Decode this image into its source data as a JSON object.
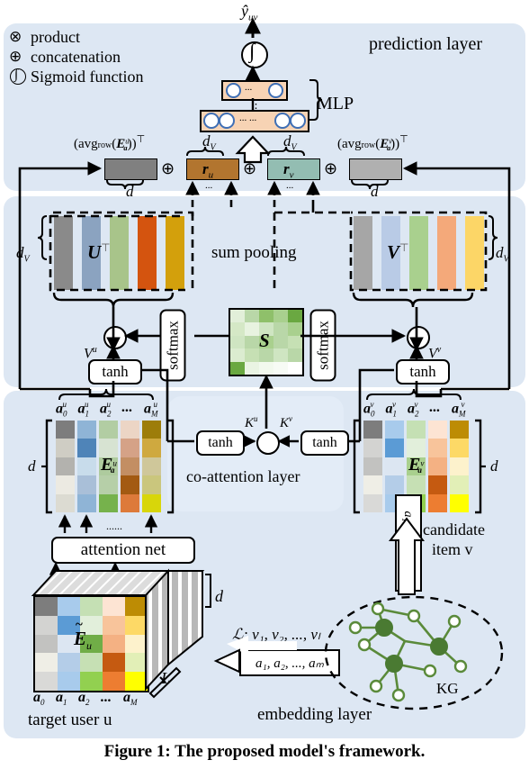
{
  "figure": {
    "caption": "Figure 1: The proposed model's framework.",
    "background": "#dde7f3"
  },
  "legend": {
    "items": [
      {
        "icon": "product-icon",
        "symbol": "⊗",
        "label": "product"
      },
      {
        "icon": "concatenation-icon",
        "symbol": "⊕",
        "label": "concatenation"
      },
      {
        "icon": "sigmoid-icon",
        "symbol": "∫",
        "label": "Sigmoid function"
      }
    ]
  },
  "layers": {
    "prediction": "prediction layer",
    "co_attention": "co-attention layer",
    "embedding": "embedding layer"
  },
  "prediction": {
    "output_label": "ŷ",
    "output_sub": "uv",
    "sigmoid_symbol": "∫",
    "mlp_label": "MLP",
    "mlp_vdots": "⋮",
    "mlp_top_dots": "...",
    "mlp_bottom_dots": "... ...",
    "dv_left": "d",
    "dv_left_sub": "V",
    "dv_right": "d",
    "dv_right_sub": "V"
  },
  "concat_row": {
    "avg_u": "(avg",
    "avg_u_subscript": "row",
    "avg_u_mid": "(",
    "avg_u_mat": "E",
    "avg_u_mat_sup": "u",
    "avg_u_mat_sub": "a",
    "avg_u_tail": "))",
    "avg_u_transpose": "⊤",
    "avg_v_mat_sup": "v",
    "r_u": "r",
    "r_u_sub": "u",
    "r_v": "r",
    "r_v_sub": "v",
    "d_left": "d",
    "d_right": "d",
    "plus_symbol": "⊕",
    "dots": "...",
    "r_u_color": "#b2752f",
    "r_v_color": "#93bdb2",
    "avg_u_color": "#808080",
    "avg_v_color": "#b0b0b0"
  },
  "attention": {
    "sum_pooling": "sum pooling",
    "U_label": "U",
    "U_transpose": "⊤",
    "V_label": "V",
    "V_transpose": "⊤",
    "dv_left": "d",
    "dv_left_sub": "V",
    "dv_right": "d",
    "dv_right_sub": "V",
    "softmax_left": "softmax",
    "softmax_right": "softmax",
    "S_label": "S",
    "tanh_left": "tanh",
    "tanh_right": "tanh",
    "V_u": "V",
    "V_u_sup": "u",
    "V_v": "V",
    "V_v_sup": "v",
    "product_symbol": "⊗",
    "U_colors": [
      "#8a8a8a",
      "#8ba3c0",
      "#a8c48a",
      "#d4540f",
      "#d3a00c"
    ],
    "V_colors": [
      "#a6a6a6",
      "#b9cbe6",
      "#a9d08e",
      "#f4a97a",
      "#fcd667"
    ]
  },
  "coattention": {
    "tanh_left": "tanh",
    "tanh_right": "tanh",
    "K_u": "K",
    "K_u_sup": "u",
    "K_v": "K",
    "K_v_sup": "v",
    "product_symbol": "⊗"
  },
  "matrix_u": {
    "name": "E",
    "sup": "u",
    "sub": "a",
    "d_label": "d",
    "col_labels": [
      "a",
      "a",
      "a",
      "...",
      "a"
    ],
    "col_subs": [
      "0",
      "1",
      "2",
      "",
      "M"
    ],
    "col_sup": "u",
    "grid": [
      [
        "#7d7d7d",
        "#8fb4d6",
        "#b2cda3",
        "#ecd5c5",
        "#9d7d0a"
      ],
      [
        "#cfcdc4",
        "#4f84b8",
        "#d7e3d2",
        "#d5a287",
        "#cfa93f"
      ],
      [
        "#b3b2ae",
        "#c8dceb",
        "#aecb9e",
        "#c38e63",
        "#cfc79a"
      ],
      [
        "#eceae2",
        "#a9bfd8",
        "#b6cfa8",
        "#a35a12",
        "#cac67d"
      ],
      [
        "#dcdbd2",
        "#8fb4d6",
        "#76b24c",
        "#dd7a3a",
        "#d8d60a"
      ]
    ]
  },
  "matrix_v": {
    "name": "E",
    "sup": "v",
    "sub": "a",
    "d_label": "d",
    "col_labels": [
      "a",
      "a",
      "a",
      "...",
      "a"
    ],
    "col_subs": [
      "0",
      "1",
      "2",
      "",
      "M"
    ],
    "col_sup": "v",
    "grid": [
      [
        "#7d7d7d",
        "#a8cbec",
        "#c5e0b4",
        "#fde4d3",
        "#bd8c04"
      ],
      [
        "#d3d3d1",
        "#5b9bd5",
        "#e2efdb",
        "#f8c49b",
        "#fdd966"
      ],
      [
        "#c2c2c0",
        "#dce6f2",
        "#a9d08e",
        "#f4b183",
        "#fdf2cc"
      ],
      [
        "#efeee6",
        "#b4cde8",
        "#c6e0b4",
        "#c55a11",
        "#e2efb7"
      ],
      [
        "#d9d9d7",
        "#a8cbec",
        "#92d050",
        "#ed7d31",
        "#ffff00"
      ]
    ]
  },
  "embedding": {
    "target_user": "target user u",
    "candidate_item_line1": "candidate",
    "candidate_item_line2": "item v",
    "attention_net": "attention net",
    "matrix_name": "E",
    "matrix_sub": "u",
    "matrix_tilde": "~",
    "d_label": "d",
    "L_label": "L",
    "list_label": "ℒ: v",
    "list_text": "ℒ: v₁, v₂, ..., vₗ",
    "list_render": "ℒ: v",
    "seq_text": "a₁, a₂, ..., aₘ",
    "seq_vertical": "a₁, a₂, ..., aₘ",
    "kg_label": "KG",
    "col_labels": [
      "a",
      "a",
      "a",
      "...",
      "a"
    ],
    "col_subs": [
      "0",
      "1",
      "2",
      "",
      "M"
    ],
    "dots_h": "......",
    "grid": [
      [
        "#7d7d7d",
        "#a8cbec",
        "#c5e0b4",
        "#fde4d3",
        "#bd8c04"
      ],
      [
        "#d3d3d1",
        "#5b9bd5",
        "#e2efdb",
        "#f8c49b",
        "#fdd966"
      ],
      [
        "#c2c2c0",
        "#dce6f2",
        "#70ad47",
        "#f4b183",
        "#fdf2cc"
      ],
      [
        "#efeee6",
        "#b4cde8",
        "#c6e0b4",
        "#c55a11",
        "#e2efb7"
      ],
      [
        "#d9d9d7",
        "#a8cbec",
        "#92d050",
        "#ed7d31",
        "#ffff00"
      ]
    ]
  },
  "smatrix": {
    "label": "S",
    "grid": [
      [
        "#e2efd9",
        "#b9d7a8",
        "#8fc06a",
        "#a9d08e",
        "#6aa841"
      ],
      [
        "#d5e8c6",
        "#e8f3e0",
        "#cfe5c2",
        "#b9d7a8",
        "#a9d08e"
      ],
      [
        "#cfe5c2",
        "#b9d7a8",
        "#a9d08e",
        "#b9d7a8",
        "#c6e0b4"
      ],
      [
        "#dbecd0",
        "#c6e0b4",
        "#b9d7a8",
        "#cfe5c2",
        "#b9d7a8"
      ],
      [
        "#6aa841",
        "#eaf4e3",
        "#f2f9ee",
        "#f7fbf5",
        "#ffffff"
      ]
    ]
  },
  "kg": {
    "label": "KG",
    "node_color": "#4a7a32",
    "edge_color": "#5a8a3a"
  }
}
